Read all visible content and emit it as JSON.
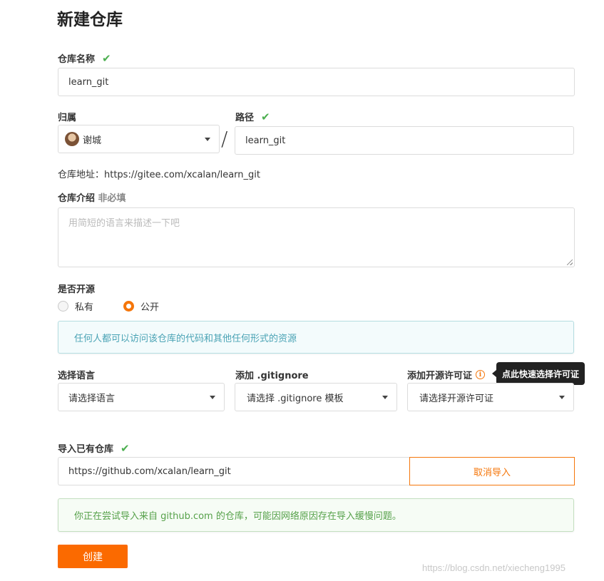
{
  "page": {
    "title": "新建仓库"
  },
  "repo_name": {
    "label": "仓库名称",
    "value": "learn_git"
  },
  "owner": {
    "label": "归属",
    "value": "谢城"
  },
  "path": {
    "label": "路径",
    "value": "learn_git",
    "separator": "/"
  },
  "repo_url": {
    "text": "仓库地址：https://gitee.com/xcalan/learn_git"
  },
  "description": {
    "label": "仓库介绍",
    "optional": "非必填",
    "placeholder": "用简短的语言来描述一下吧"
  },
  "visibility": {
    "label": "是否开源",
    "options": [
      {
        "label": "私有",
        "selected": false
      },
      {
        "label": "公开",
        "selected": true
      }
    ],
    "info": "任何人都可以访问该仓库的代码和其他任何形式的资源"
  },
  "language": {
    "label": "选择语言",
    "value": "请选择语言"
  },
  "gitignore": {
    "label": "添加 .gitignore",
    "value": "请选择 .gitignore 模板"
  },
  "license": {
    "label": "添加开源许可证",
    "value": "请选择开源许可证",
    "tooltip": "点此快速选择许可证",
    "icon": "info-icon"
  },
  "import": {
    "label": "导入已有仓库",
    "value": "https://github.com/xcalan/learn_git",
    "cancel_label": "取消导入",
    "notice": "你正在尝试导入来自 github.com 的仓库，可能因网络原因存在导入缓慢问题。"
  },
  "create_button": {
    "label": "创建"
  },
  "watermark": "https://blog.csdn.net/xiecheng1995",
  "colors": {
    "accent": "#fb6a00",
    "check": "#4caf50",
    "info": "#4aa3b5",
    "success": "#56a14a"
  }
}
